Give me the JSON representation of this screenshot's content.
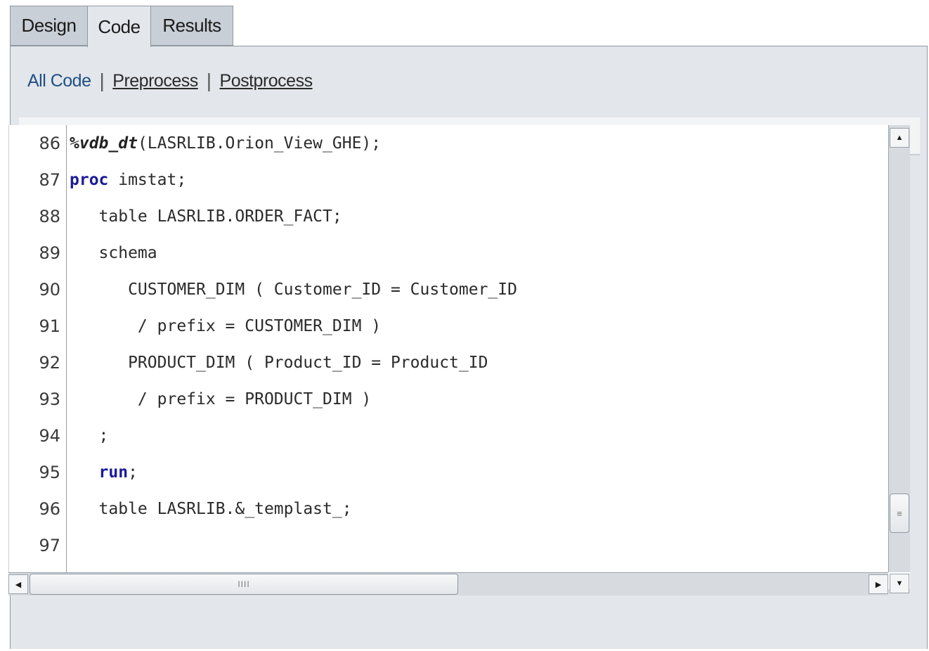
{
  "tabs": [
    {
      "label": "Design"
    },
    {
      "label": "Code"
    },
    {
      "label": "Results"
    }
  ],
  "subnav": {
    "all_code": "All Code",
    "preprocess": "Preprocess",
    "postprocess": "Postprocess",
    "separator": "|"
  },
  "toolbar": {
    "print_icon": "≜",
    "refresh_icon": "↻"
  },
  "code": {
    "lines": [
      {
        "num": "86",
        "text": "(LASRLIB.Orion_View_GHE);",
        "macro": "%vdb_dt"
      },
      {
        "num": "87",
        "kw": "proc",
        "text": " imstat;"
      },
      {
        "num": "88",
        "text": "   table LASRLIB.ORDER_FACT;"
      },
      {
        "num": "89",
        "text": "   schema"
      },
      {
        "num": "90",
        "text": "      CUSTOMER_DIM ( Customer_ID = Customer_ID"
      },
      {
        "num": "91",
        "text": "       / prefix = CUSTOMER_DIM )"
      },
      {
        "num": "92",
        "text": "      PRODUCT_DIM ( Product_ID = Product_ID"
      },
      {
        "num": "93",
        "text": "       / prefix = PRODUCT_DIM )"
      },
      {
        "num": "94",
        "text": "   ;"
      },
      {
        "num": "95",
        "indent": "   ",
        "kw": "run",
        "text": ";"
      },
      {
        "num": "96",
        "text": "   table LASRLIB.&_templast_;"
      },
      {
        "num": "97",
        "text": ""
      }
    ]
  },
  "scrollbar": {
    "up": "▲",
    "down": "▼",
    "left": "◀",
    "right": "▶",
    "vgrip": "≡",
    "hgrip": "IIII"
  }
}
